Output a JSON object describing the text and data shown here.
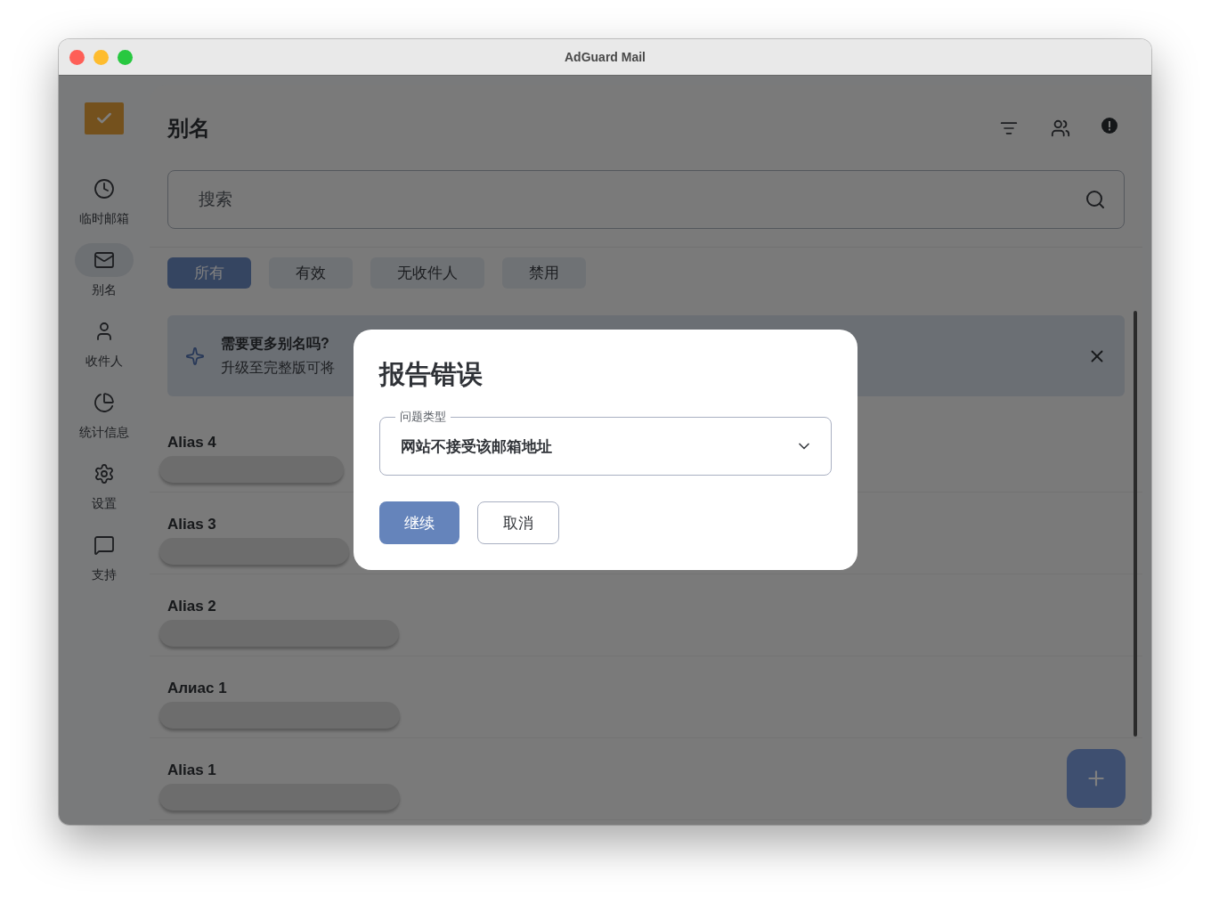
{
  "window": {
    "title": "AdGuard Mail"
  },
  "sidebar": {
    "items": [
      {
        "label": "临时邮箱",
        "selected": false
      },
      {
        "label": "别名",
        "selected": true
      },
      {
        "label": "收件人",
        "selected": false
      },
      {
        "label": "统计信息",
        "selected": false
      },
      {
        "label": "设置",
        "selected": false
      },
      {
        "label": "支持",
        "selected": false
      }
    ]
  },
  "header": {
    "title": "别名"
  },
  "search": {
    "placeholder": "搜索"
  },
  "filters": [
    {
      "label": "所有",
      "selected": true
    },
    {
      "label": "有效",
      "selected": false
    },
    {
      "label": "无收件人",
      "selected": false
    },
    {
      "label": "禁用",
      "selected": false
    }
  ],
  "banner": {
    "title": "需要更多别名吗?",
    "text": "升级至完整版可将"
  },
  "aliases": [
    {
      "name": "Alias 4"
    },
    {
      "name": "Alias 3"
    },
    {
      "name": "Alias 2"
    },
    {
      "name": "Алиас 1"
    },
    {
      "name": "Alias 1"
    }
  ],
  "dialog": {
    "title": "报告错误",
    "field": {
      "label": "问题类型",
      "value": "网站不接受该邮箱地址"
    },
    "buttons": [
      {
        "label": "继续",
        "kind": "primary"
      },
      {
        "label": "取消",
        "kind": "secondary"
      }
    ]
  }
}
